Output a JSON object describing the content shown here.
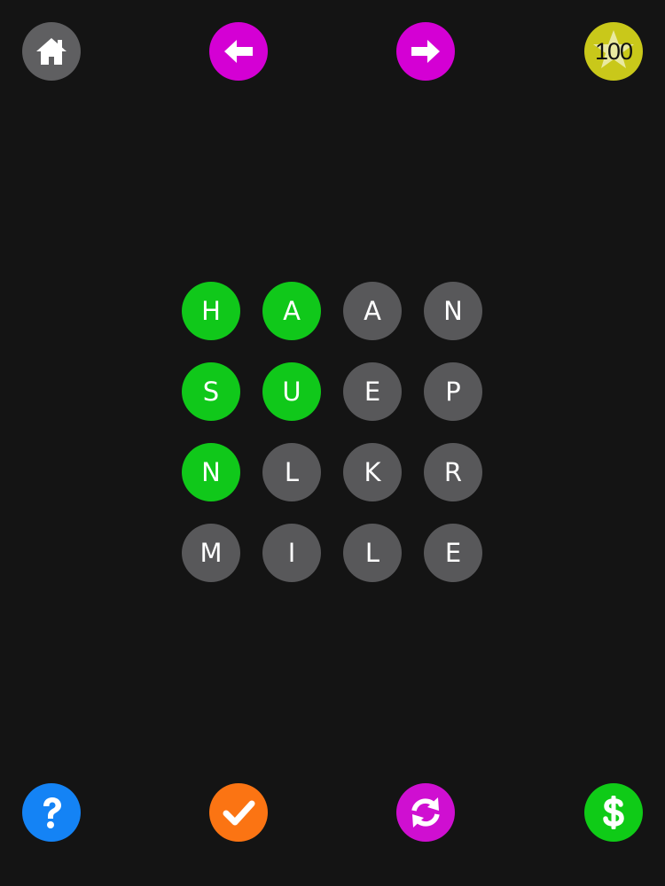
{
  "colors": {
    "background": "#141414",
    "home": "#5f5f61",
    "arrows": "#d400d4",
    "score": "#c9c81a",
    "help": "#1483f5",
    "check": "#fb7413",
    "refresh": "#cf0fd1",
    "coins": "#0fcb17",
    "tile_selected": "#10c81a",
    "tile_default": "#58585a"
  },
  "top_bar": {
    "home_icon": "home-icon",
    "back_icon": "arrow-left-icon",
    "next_icon": "arrow-right-icon",
    "score_value": "100",
    "score_icon": "star-icon"
  },
  "bottom_bar": {
    "help_icon": "question-icon",
    "check_icon": "checkmark-icon",
    "refresh_icon": "refresh-icon",
    "coins_icon": "dollar-icon"
  },
  "board": {
    "rows": [
      [
        {
          "letter": "H",
          "selected": true
        },
        {
          "letter": "A",
          "selected": true
        },
        {
          "letter": "A",
          "selected": false
        },
        {
          "letter": "N",
          "selected": false
        }
      ],
      [
        {
          "letter": "S",
          "selected": true
        },
        {
          "letter": "U",
          "selected": true
        },
        {
          "letter": "E",
          "selected": false
        },
        {
          "letter": "P",
          "selected": false
        }
      ],
      [
        {
          "letter": "N",
          "selected": true
        },
        {
          "letter": "L",
          "selected": false
        },
        {
          "letter": "K",
          "selected": false
        },
        {
          "letter": "R",
          "selected": false
        }
      ],
      [
        {
          "letter": "M",
          "selected": false
        },
        {
          "letter": "I",
          "selected": false
        },
        {
          "letter": "L",
          "selected": false
        },
        {
          "letter": "E",
          "selected": false
        }
      ]
    ]
  }
}
